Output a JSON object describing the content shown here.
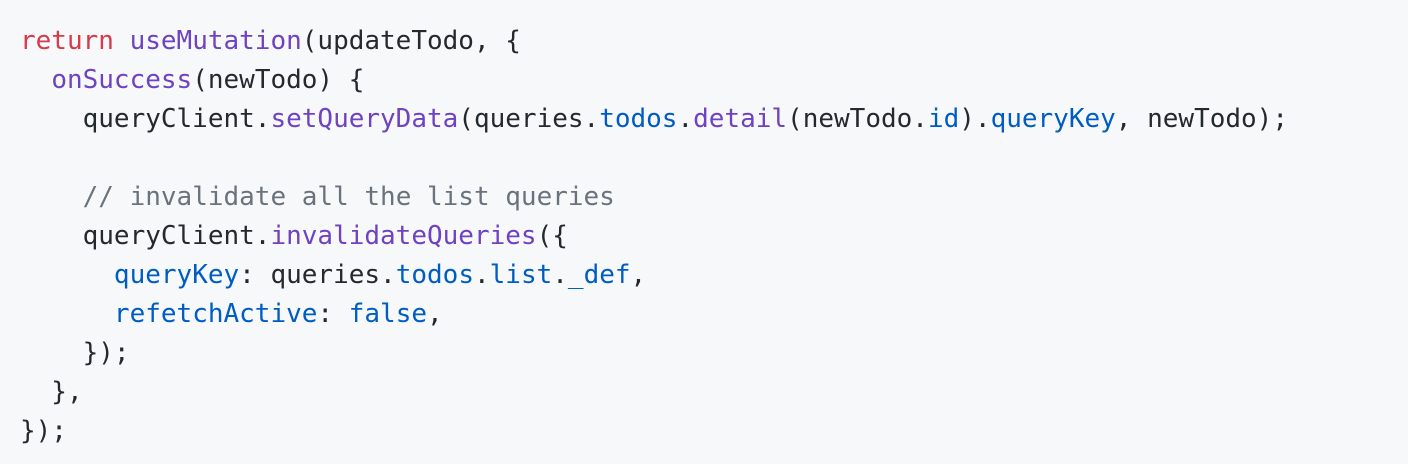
{
  "code_block": {
    "colors": {
      "background": "#f6f8fa",
      "default": "#24292e",
      "keyword": "#d73a49",
      "function": "#6f42c1",
      "property": "#005cc5",
      "comment": "#6a737d"
    },
    "lines": [
      {
        "tokens": [
          {
            "t": "return",
            "k": "kw"
          },
          {
            "t": " ",
            "k": "pl"
          },
          {
            "t": "useMutation",
            "k": "fn"
          },
          {
            "t": "(updateTodo, {",
            "k": "pl"
          }
        ]
      },
      {
        "tokens": [
          {
            "t": "  ",
            "k": "pl"
          },
          {
            "t": "onSuccess",
            "k": "fn"
          },
          {
            "t": "(newTodo) {",
            "k": "pl"
          }
        ]
      },
      {
        "tokens": [
          {
            "t": "    queryClient.",
            "k": "pl"
          },
          {
            "t": "setQueryData",
            "k": "fn"
          },
          {
            "t": "(queries.",
            "k": "pl"
          },
          {
            "t": "todos",
            "k": "prop"
          },
          {
            "t": ".",
            "k": "pl"
          },
          {
            "t": "detail",
            "k": "fn"
          },
          {
            "t": "(newTodo.",
            "k": "pl"
          },
          {
            "t": "id",
            "k": "prop"
          },
          {
            "t": ").",
            "k": "pl"
          },
          {
            "t": "queryKey",
            "k": "prop"
          },
          {
            "t": ", newTodo);",
            "k": "pl"
          }
        ]
      },
      {
        "tokens": []
      },
      {
        "tokens": [
          {
            "t": "    ",
            "k": "pl"
          },
          {
            "t": "// invalidate all the list queries",
            "k": "cm"
          }
        ]
      },
      {
        "tokens": [
          {
            "t": "    queryClient.",
            "k": "pl"
          },
          {
            "t": "invalidateQueries",
            "k": "fn"
          },
          {
            "t": "({",
            "k": "pl"
          }
        ]
      },
      {
        "tokens": [
          {
            "t": "      ",
            "k": "pl"
          },
          {
            "t": "queryKey",
            "k": "prop"
          },
          {
            "t": ": queries.",
            "k": "pl"
          },
          {
            "t": "todos",
            "k": "prop"
          },
          {
            "t": ".",
            "k": "pl"
          },
          {
            "t": "list",
            "k": "prop"
          },
          {
            "t": ".",
            "k": "pl"
          },
          {
            "t": "_def",
            "k": "prop"
          },
          {
            "t": ",",
            "k": "pl"
          }
        ]
      },
      {
        "tokens": [
          {
            "t": "      ",
            "k": "pl"
          },
          {
            "t": "refetchActive",
            "k": "prop"
          },
          {
            "t": ": ",
            "k": "pl"
          },
          {
            "t": "false",
            "k": "const"
          },
          {
            "t": ",",
            "k": "pl"
          }
        ]
      },
      {
        "tokens": [
          {
            "t": "    });",
            "k": "pl"
          }
        ]
      },
      {
        "tokens": [
          {
            "t": "  },",
            "k": "pl"
          }
        ]
      },
      {
        "tokens": [
          {
            "t": "});",
            "k": "pl"
          }
        ]
      }
    ]
  }
}
